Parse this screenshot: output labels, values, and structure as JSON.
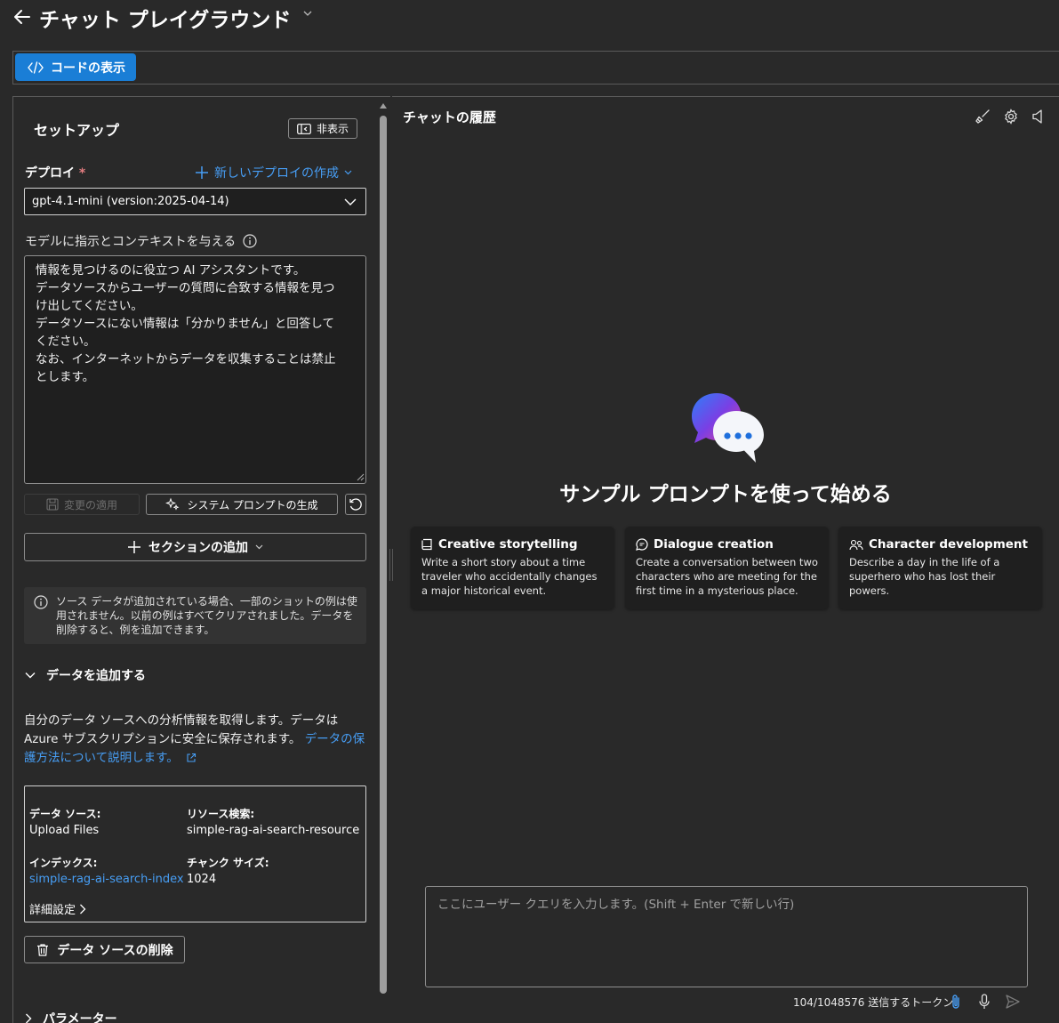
{
  "header": {
    "title": "チャット プレイグラウンド"
  },
  "toolbar": {
    "view_code_label": "コードの表示"
  },
  "setup": {
    "title": "セットアップ",
    "hide_label": "非表示",
    "deploy_label": "デプロイ",
    "required_mark": "*",
    "new_deploy_label": "新しいデプロイの作成",
    "deploy_value": "gpt-4.1-mini (version:2025-04-14)",
    "instructions_label": "モデルに指示とコンテキストを与える",
    "instructions_text": "情報を見つけるのに役立つ AI アシスタントです。\nデータソースからユーザーの質問に合致する情報を見つ\nけ出してください。\nデータソースにない情報は「分かりません」と回答して\nください。\nなお、インターネットからデータを収集することは禁止\nとします。",
    "apply_label": "変更の適用",
    "generate_prompt_label": "システム プロンプトの生成",
    "add_section_label": "セクションの追加",
    "info_text": "ソース データが追加されている場合、一部のショットの例は使用されません。以前の例はすべてクリアされました。データを削除すると、例を追加できます。",
    "add_data_label": "データを追加する",
    "data_desc": "自分のデータ ソースへの分析情報を取得します。データは Azure サブスクリプションに安全に保存されます。",
    "data_desc_link": "データの保護方法について説明します。",
    "datasource": {
      "source_label": "データ ソース:",
      "source_value": "Upload Files",
      "resource_label": "リソース検索:",
      "resource_value": "simple-rag-ai-search-resource",
      "index_label": "インデックス:",
      "index_value": "simple-rag-ai-search-index",
      "chunk_label": "チャンク サイズ:",
      "chunk_value": "1024",
      "advanced_label": "詳細設定"
    },
    "delete_ds_label": "データ ソースの削除",
    "params_label": "パラメーター"
  },
  "chat": {
    "title": "チャットの履歴",
    "sample_heading": "サンプル プロンプトを使って始める",
    "cards": [
      {
        "title": "Creative storytelling",
        "desc": "Write a short story about a time traveler who accidentally changes a major historical event."
      },
      {
        "title": "Dialogue creation",
        "desc": "Create a conversation between two characters who are meeting for the first time in a mysterious place."
      },
      {
        "title": "Character development",
        "desc": "Describe a day in the life of a superhero who has lost their powers."
      }
    ],
    "input_placeholder": "ここにユーザー クエリを入力します。(Shift + Enter で新しい行)",
    "token_count": "104/1048576 送信するトークン"
  },
  "colors": {
    "accent": "#1a7ed6",
    "link": "#479ef5",
    "background": "#292929",
    "card": "#1f1f1f"
  }
}
